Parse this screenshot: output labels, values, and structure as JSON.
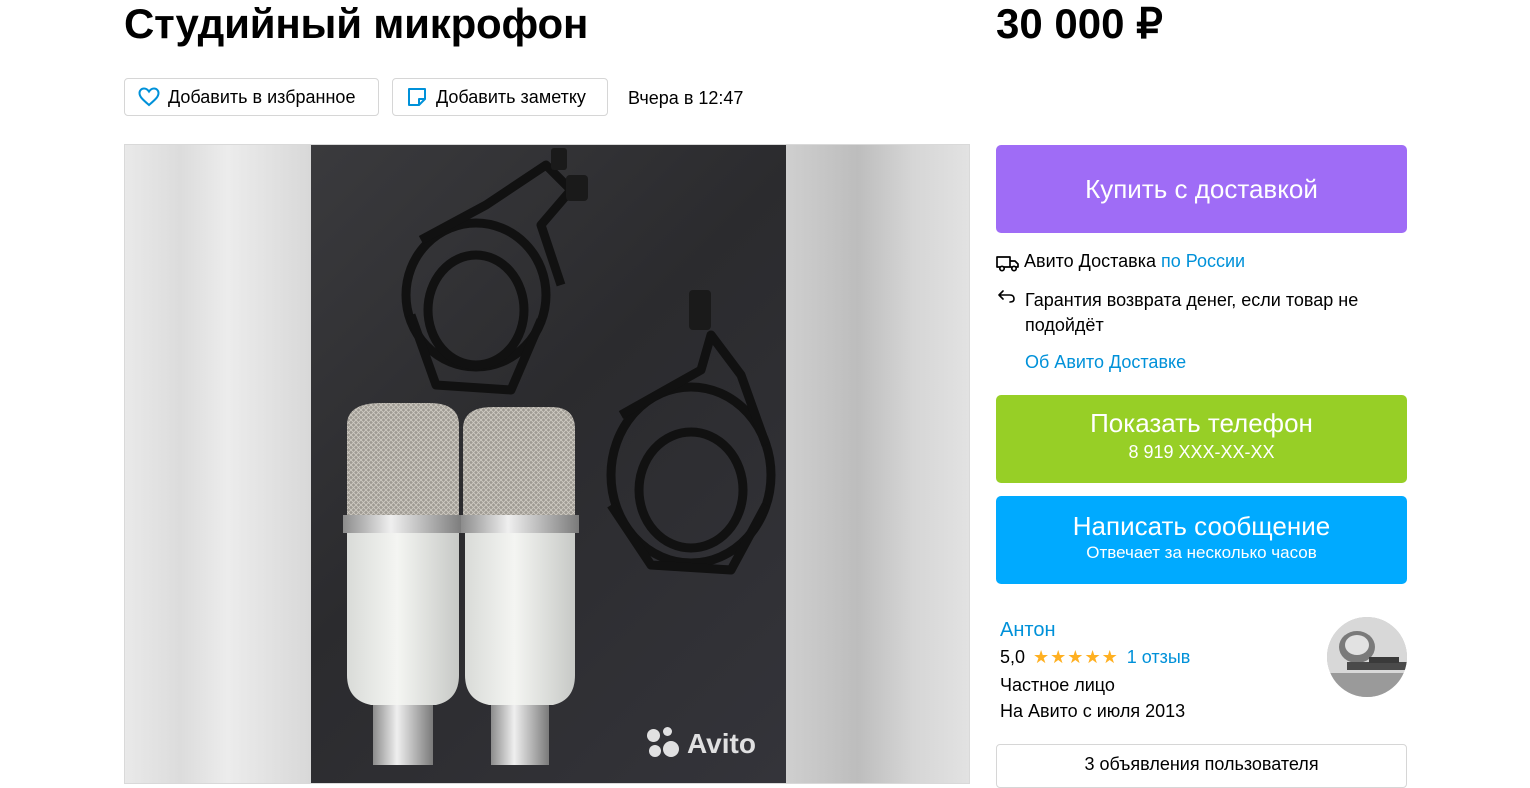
{
  "title": "Студийный микрофон",
  "price": "30 000 ₽",
  "actions": {
    "favorite_label": "Добавить в избранное",
    "note_label": "Добавить заметку",
    "date": "Вчера в 12:47"
  },
  "gallery": {
    "watermark": "Avito",
    "image_icon": "microphone-photo"
  },
  "delivery": {
    "buy_label": "Купить с доставкой",
    "service": "Авито Доставка",
    "region_link": "по России",
    "guarantee": "Гарантия возврата денег, если товар не подойдёт",
    "about_link": "Об Авито Доставке",
    "icons": [
      "truck-icon",
      "return-arrow-icon"
    ]
  },
  "contact": {
    "phone_label": "Показать телефон",
    "phone_number": "8 919 XXX-XX-XX",
    "message_label": "Написать сообщение",
    "message_sub": "Отвечает за несколько часов"
  },
  "seller": {
    "name": "Антон",
    "rating": "5,0",
    "stars": "★★★★★",
    "reviews": "1 отзыв",
    "type": "Частное лицо",
    "since": "На Авито с июля 2013",
    "ads_label": "3 объявления пользователя"
  },
  "colors": {
    "buy": "#9f6cf6",
    "phone": "#97cf26",
    "message": "#00aaff",
    "link": "#0091d9",
    "stars": "#ffb021"
  }
}
